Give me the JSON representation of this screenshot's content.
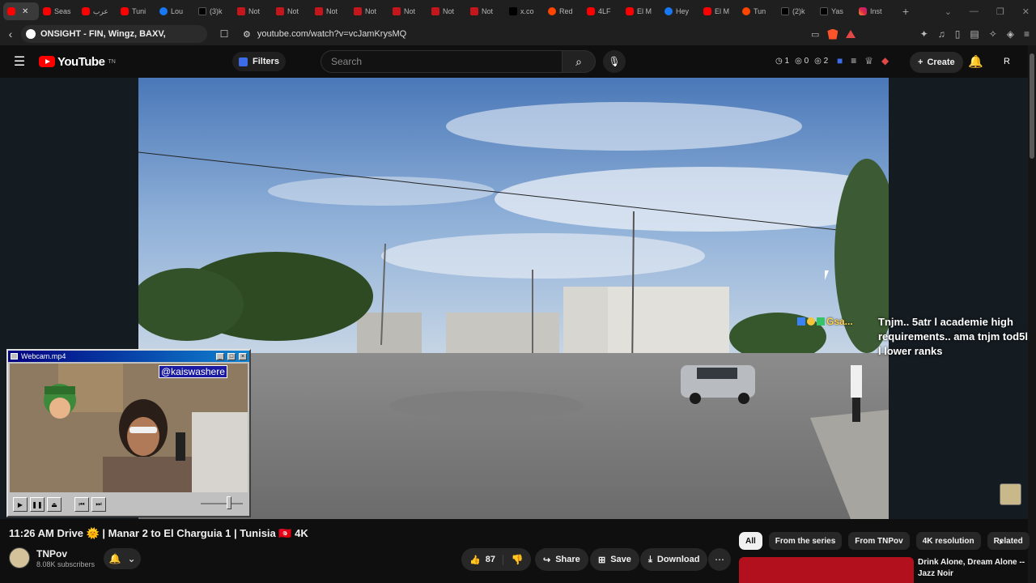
{
  "browser": {
    "tabs": [
      {
        "icon": "yt",
        "label": ""
      },
      {
        "icon": "yt",
        "label": "Seas"
      },
      {
        "icon": "yt",
        "label": "عرب"
      },
      {
        "icon": "yt",
        "label": "Tuni"
      },
      {
        "icon": "fb",
        "label": "Lou"
      },
      {
        "icon": "tt",
        "label": "(3)k"
      },
      {
        "icon": "nt",
        "label": "Not"
      },
      {
        "icon": "nt",
        "label": "Not"
      },
      {
        "icon": "nt",
        "label": "Not"
      },
      {
        "icon": "nt",
        "label": "Not"
      },
      {
        "icon": "nt",
        "label": "Not"
      },
      {
        "icon": "nt",
        "label": "Not"
      },
      {
        "icon": "nt",
        "label": "Not"
      },
      {
        "icon": "x",
        "label": "x.co"
      },
      {
        "icon": "rd",
        "label": "Red"
      },
      {
        "icon": "yt",
        "label": "4LF"
      },
      {
        "icon": "yt",
        "label": "El M"
      },
      {
        "icon": "fb",
        "label": "Hey"
      },
      {
        "icon": "yt",
        "label": "El M"
      },
      {
        "icon": "rd",
        "label": "Tun"
      },
      {
        "icon": "tt",
        "label": "(2)k"
      },
      {
        "icon": "tt",
        "label": "Yas"
      },
      {
        "icon": "ig",
        "label": "Inst"
      }
    ],
    "context_title": "ONSIGHT - FIN, Wingz, BAXV,",
    "url": "youtube.com/watch?v=vcJamKrysMQ"
  },
  "yt": {
    "logo_text": "YouTube",
    "logo_sup": "TN",
    "filters_label": "Filters",
    "search_placeholder": "Search",
    "counters": [
      "1",
      "0",
      "2"
    ],
    "create_label": "Create",
    "avatar_letter": "R"
  },
  "overlay": {
    "chat_tag": "Gsa...",
    "chat_text": "Tnjm.. 5atr l academie high requirements.. ama tnjm tod5l l lower ranks"
  },
  "webcam": {
    "title": "Webcam.mp4",
    "handle": "@kaiswashere"
  },
  "video": {
    "title": "11:26 AM Drive 🌞 | Manar 2 to El Charguia 1 | Tunisia 🇹🇳 4K",
    "channel": "TNPov",
    "subscribers": "8.08K subscribers",
    "likes": "87",
    "share_label": "Share",
    "save_label": "Save",
    "download_label": "Download"
  },
  "chips": [
    "All",
    "From the series",
    "From TNPov",
    "4K resolution",
    "Related"
  ],
  "recommendation": {
    "title": "Drink Alone, Dream Alone -- Jazz Noir"
  },
  "colors": {
    "accent_red": "#ff0000",
    "background": "#0f0f0f",
    "surface": "#272727"
  }
}
